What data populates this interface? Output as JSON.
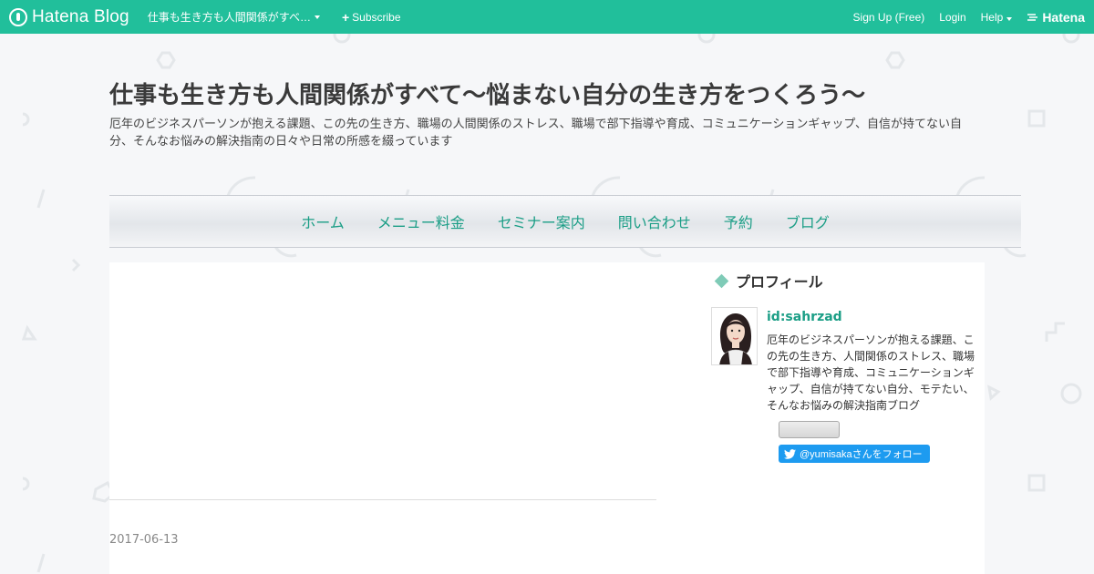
{
  "topbar": {
    "brand": "Hatena Blog",
    "blog_name": "仕事も生き方も人間関係がすべ…",
    "subscribe": "Subscribe",
    "signup": "Sign Up (Free)",
    "login": "Login",
    "help": "Help",
    "hatena": "Hatena",
    "bg_color": "#21bf9b"
  },
  "header": {
    "title": "仕事も生き方も人間関係がすべて〜悩まない自分の生き方をつくろう〜",
    "description": "厄年のビジネスパーソンが抱える課題、この先の生き方、職場の人間関係のストレス、職場で部下指導や育成、コミュニケーションギャップ、自信が持てない自分、そんなお悩みの解決指南の日々や日常の所感を綴っています"
  },
  "nav": {
    "items": [
      "ホーム",
      "メニュー料金",
      "セミナー案内",
      "問い合わせ",
      "予約",
      "ブログ"
    ],
    "color": "#1b9e86"
  },
  "main": {
    "post_date": "2017-06-13"
  },
  "sidebar": {
    "heading": "プロフィール",
    "profile_id": "id:sahrzad",
    "profile_desc": "厄年のビジネスパーソンが抱える課題、この先の生き方、人間関係のストレス、職場で部下指導や育成、コミュニケーションギャップ、自信が持てない自分、モテたい、そんなお悩みの解決指南ブログ",
    "twitter_follow": "@yumisakaさんをフォロー"
  }
}
